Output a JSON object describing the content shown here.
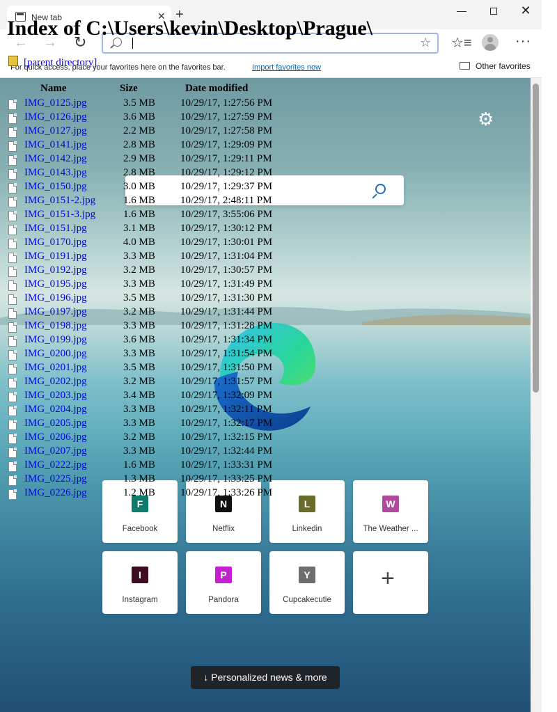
{
  "browser": {
    "tab_title": "New tab",
    "tab_close": "✕",
    "new_tab": "+",
    "window_minimize": "—",
    "window_close": "✕",
    "address_value": "",
    "back_icon": "←",
    "forward_icon": "→",
    "refresh_icon": "↻",
    "star_icon": "☆",
    "favorites_icon": "☆≡",
    "more_icon": "···"
  },
  "favorites_bar": {
    "message": "For quick access, place your favorites here on the favorites bar.",
    "import_link": "Import favorites now",
    "other_favorites": "Other favorites"
  },
  "directory": {
    "heading": "Index of C:\\Users\\kevin\\Desktop\\Prague\\",
    "parent_link": "[parent directory]",
    "columns": {
      "name": "Name",
      "size": "Size",
      "date": "Date modified"
    },
    "files": [
      {
        "name": "IMG_0125.jpg",
        "size": "3.5 MB",
        "date": "10/29/17, 1:27:56 PM"
      },
      {
        "name": "IMG_0126.jpg",
        "size": "3.6 MB",
        "date": "10/29/17, 1:27:59 PM"
      },
      {
        "name": "IMG_0127.jpg",
        "size": "2.2 MB",
        "date": "10/29/17, 1:27:58 PM"
      },
      {
        "name": "IMG_0141.jpg",
        "size": "2.8 MB",
        "date": "10/29/17, 1:29:09 PM"
      },
      {
        "name": "IMG_0142.jpg",
        "size": "2.9 MB",
        "date": "10/29/17, 1:29:11 PM"
      },
      {
        "name": "IMG_0143.jpg",
        "size": "2.8 MB",
        "date": "10/29/17, 1:29:12 PM"
      },
      {
        "name": "IMG_0150.jpg",
        "size": "3.0 MB",
        "date": "10/29/17, 1:29:37 PM"
      },
      {
        "name": "IMG_0151-2.jpg",
        "size": "1.6 MB",
        "date": "10/29/17, 2:48:11 PM"
      },
      {
        "name": "IMG_0151-3.jpg",
        "size": "1.6 MB",
        "date": "10/29/17, 3:55:06 PM"
      },
      {
        "name": "IMG_0151.jpg",
        "size": "3.1 MB",
        "date": "10/29/17, 1:30:12 PM"
      },
      {
        "name": "IMG_0170.jpg",
        "size": "4.0 MB",
        "date": "10/29/17, 1:30:01 PM"
      },
      {
        "name": "IMG_0191.jpg",
        "size": "3.3 MB",
        "date": "10/29/17, 1:31:04 PM"
      },
      {
        "name": "IMG_0192.jpg",
        "size": "3.2 MB",
        "date": "10/29/17, 1:30:57 PM"
      },
      {
        "name": "IMG_0195.jpg",
        "size": "3.3 MB",
        "date": "10/29/17, 1:31:49 PM"
      },
      {
        "name": "IMG_0196.jpg",
        "size": "3.5 MB",
        "date": "10/29/17, 1:31:30 PM"
      },
      {
        "name": "IMG_0197.jpg",
        "size": "3.2 MB",
        "date": "10/29/17, 1:31:44 PM"
      },
      {
        "name": "IMG_0198.jpg",
        "size": "3.3 MB",
        "date": "10/29/17, 1:31:28 PM"
      },
      {
        "name": "IMG_0199.jpg",
        "size": "3.6 MB",
        "date": "10/29/17, 1:31:34 PM"
      },
      {
        "name": "IMG_0200.jpg",
        "size": "3.3 MB",
        "date": "10/29/17, 1:31:54 PM"
      },
      {
        "name": "IMG_0201.jpg",
        "size": "3.5 MB",
        "date": "10/29/17, 1:31:50 PM"
      },
      {
        "name": "IMG_0202.jpg",
        "size": "3.2 MB",
        "date": "10/29/17, 1:31:57 PM"
      },
      {
        "name": "IMG_0203.jpg",
        "size": "3.4 MB",
        "date": "10/29/17, 1:32:09 PM"
      },
      {
        "name": "IMG_0204.jpg",
        "size": "3.3 MB",
        "date": "10/29/17, 1:32:11 PM"
      },
      {
        "name": "IMG_0205.jpg",
        "size": "3.3 MB",
        "date": "10/29/17, 1:32:17 PM"
      },
      {
        "name": "IMG_0206.jpg",
        "size": "3.2 MB",
        "date": "10/29/17, 1:32:15 PM"
      },
      {
        "name": "IMG_0207.jpg",
        "size": "3.3 MB",
        "date": "10/29/17, 1:32:44 PM"
      },
      {
        "name": "IMG_0222.jpg",
        "size": "1.6 MB",
        "date": "10/29/17, 1:33:31 PM"
      },
      {
        "name": "IMG_0225.jpg",
        "size": "1.3 MB",
        "date": "10/29/17, 1:33:25 PM"
      },
      {
        "name": "IMG_0226.jpg",
        "size": "1.2 MB",
        "date": "10/29/17, 1:33:26 PM"
      }
    ]
  },
  "new_tab_page": {
    "settings_icon": "gear-icon",
    "search_placeholder": "",
    "tiles": [
      {
        "letter": "F",
        "label": "Facebook",
        "color": "#0f7b6c"
      },
      {
        "letter": "N",
        "label": "Netflix",
        "color": "#111111"
      },
      {
        "letter": "L",
        "label": "Linkedin",
        "color": "#6b6b2c"
      },
      {
        "letter": "W",
        "label": "The Weather ...",
        "color": "#b04a9d"
      },
      {
        "letter": "I",
        "label": "Instagram",
        "color": "#3d0b22"
      },
      {
        "letter": "P",
        "label": "Pandora",
        "color": "#c41fd1"
      },
      {
        "letter": "Y",
        "label": "Cupcakecutie",
        "color": "#6e6e6e"
      }
    ],
    "add_tile": "+",
    "news_button": "↓  Personalized news & more"
  }
}
